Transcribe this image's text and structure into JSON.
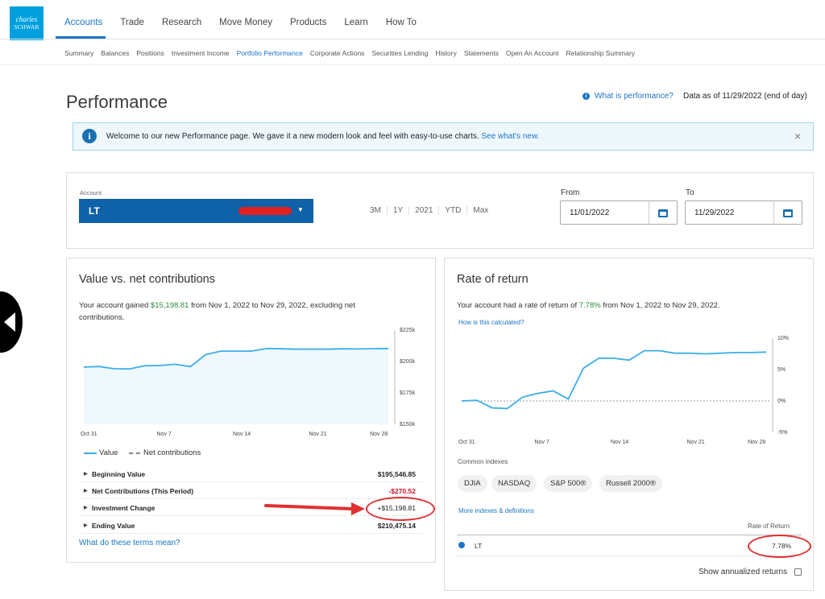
{
  "logo": {
    "line1": "charles",
    "line2": "SCHWAB"
  },
  "topnav": [
    "Accounts",
    "Trade",
    "Research",
    "Move Money",
    "Products",
    "Learn",
    "How To"
  ],
  "subnav": [
    "Summary",
    "Balances",
    "Positions",
    "Investment Income",
    "Portfolio Performance",
    "Corporate Actions",
    "Securities Lending",
    "History",
    "Statements",
    "Open An Account",
    "Relationship Summary"
  ],
  "page": {
    "title": "Performance",
    "what_is": "What is performance?",
    "data_asof": "Data as of 11/29/2022 (end of day)"
  },
  "banner": {
    "text": "Welcome to our new Performance page. We gave it a new modern look and feel with easy-to-use charts.",
    "link": "See what's new.",
    "close": "×"
  },
  "account": {
    "label": "Account",
    "name": "LT",
    "periods": [
      "3M",
      "1Y",
      "2021",
      "YTD",
      "Max"
    ],
    "from_label": "From",
    "from_value": "11/01/2022",
    "to_label": "To",
    "to_value": "11/29/2022"
  },
  "value_panel": {
    "title": "Value vs. net contributions",
    "text_pre": "Your account gained ",
    "gain": "$15,198.81",
    "text_post": " from Nov 1, 2022 to Nov 29, 2022, excluding net contributions.",
    "legend_value": "Value",
    "legend_net": "Net contributions",
    "rows": [
      {
        "label": "Beginning Value",
        "value": "$195,546.85"
      },
      {
        "label": "Net Contributions (This Period)",
        "value": "-$270.52"
      },
      {
        "label": "Investment Change",
        "value": "+$15,198.81"
      },
      {
        "label": "Ending Value",
        "value": "$210,475.14"
      }
    ],
    "terms_link": "What do these terms mean?"
  },
  "return_panel": {
    "title": "Rate of return",
    "text_pre": "Your account had a rate of return of ",
    "rate": "7.78%",
    "text_post": " from Nov 1, 2022 to Nov 29, 2022.",
    "how_link": "How is this calculated?",
    "common_label": "Common indexes",
    "indexes": [
      "DJIA",
      "NASDAQ",
      "S&P 500®",
      "Russell 2000®"
    ],
    "more_link": "More indexes & definitions",
    "table_header": "Rate of Return",
    "row_name": "LT",
    "row_value": "7.78%",
    "annualized": "Show annualized returns"
  },
  "colors": {
    "accent": "#1a74c4",
    "series": "#3aaee8",
    "negative": "#c8102e",
    "positive": "#2a8a3e",
    "annotation": "#e03030"
  },
  "chart_data": [
    {
      "type": "area",
      "x": [
        "Oct 31",
        "Nov 1",
        "Nov 2",
        "Nov 3",
        "Nov 4",
        "Nov 7",
        "Nov 8",
        "Nov 9",
        "Nov 10",
        "Nov 11",
        "Nov 14",
        "Nov 15",
        "Nov 16",
        "Nov 17",
        "Nov 18",
        "Nov 21",
        "Nov 22",
        "Nov 23",
        "Nov 25",
        "Nov 28",
        "Nov 29"
      ],
      "x_ticks": [
        "Oct 31",
        "Nov 7",
        "Nov 14",
        "Nov 21",
        "Nov 28"
      ],
      "series": [
        {
          "name": "Value",
          "values": [
            195500,
            196000,
            194200,
            194100,
            196600,
            196800,
            197800,
            195900,
            205500,
            208300,
            208300,
            208300,
            210300,
            210100,
            209800,
            209900,
            209800,
            210100,
            210000,
            210200,
            210400
          ]
        }
      ],
      "y_ticks": [
        "$225k",
        "$200k",
        "$175k",
        "$150k"
      ],
      "ylim": [
        150000,
        225000
      ]
    },
    {
      "type": "line",
      "x": [
        "Oct 31",
        "Nov 1",
        "Nov 2",
        "Nov 3",
        "Nov 4",
        "Nov 7",
        "Nov 8",
        "Nov 9",
        "Nov 10",
        "Nov 11",
        "Nov 14",
        "Nov 15",
        "Nov 16",
        "Nov 17",
        "Nov 18",
        "Nov 21",
        "Nov 22",
        "Nov 23",
        "Nov 25",
        "Nov 28",
        "Nov 29"
      ],
      "x_ticks": [
        "Oct 31",
        "Nov 7",
        "Nov 14",
        "Nov 21",
        "Nov 28"
      ],
      "series": [
        {
          "name": "LT",
          "values": [
            0,
            0.1,
            -1.1,
            -1.2,
            0.6,
            1.2,
            1.6,
            0.3,
            5.2,
            6.8,
            6.8,
            6.5,
            8.0,
            8.0,
            7.6,
            7.6,
            7.5,
            7.6,
            7.7,
            7.7,
            7.78
          ]
        }
      ],
      "y_ticks": [
        "10%",
        "5%",
        "0%",
        "-5%"
      ],
      "ylim": [
        -5,
        10
      ]
    }
  ]
}
